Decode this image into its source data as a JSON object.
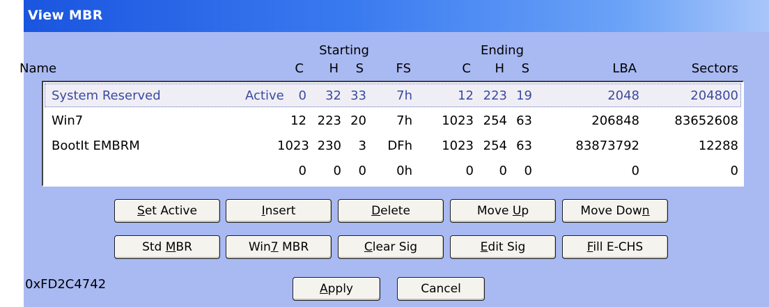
{
  "window": {
    "title": "View MBR"
  },
  "headers": {
    "group_starting": "Starting",
    "group_ending": "Ending",
    "name": "Name",
    "start_c": "C",
    "start_h": "H",
    "start_s": "S",
    "fs": "FS",
    "end_c": "C",
    "end_h": "H",
    "end_s": "S",
    "lba": "LBA",
    "sectors": "Sectors"
  },
  "partitions": [
    {
      "name": "System Reserved",
      "flag": "Active",
      "start_c": "0",
      "start_h": "32",
      "start_s": "33",
      "fs": "7h",
      "end_c": "12",
      "end_h": "223",
      "end_s": "19",
      "lba": "2048",
      "sectors": "204800"
    },
    {
      "name": "Win7",
      "flag": "",
      "start_c": "12",
      "start_h": "223",
      "start_s": "20",
      "fs": "7h",
      "end_c": "1023",
      "end_h": "254",
      "end_s": "63",
      "lba": "206848",
      "sectors": "83652608"
    },
    {
      "name": "BootIt EMBRM",
      "flag": "",
      "start_c": "1023",
      "start_h": "230",
      "start_s": "3",
      "fs": "DFh",
      "end_c": "1023",
      "end_h": "254",
      "end_s": "63",
      "lba": "83873792",
      "sectors": "12288"
    },
    {
      "name": "",
      "flag": "",
      "start_c": "0",
      "start_h": "0",
      "start_s": "0",
      "fs": "0h",
      "end_c": "0",
      "end_h": "0",
      "end_s": "0",
      "lba": "0",
      "sectors": "0"
    }
  ],
  "buttons": {
    "set_active": {
      "pre": "",
      "key": "S",
      "post": "et Active"
    },
    "insert": {
      "pre": "",
      "key": "I",
      "post": "nsert"
    },
    "delete": {
      "pre": "",
      "key": "D",
      "post": "elete"
    },
    "move_up": {
      "pre": "Move ",
      "key": "U",
      "post": "p"
    },
    "move_down": {
      "pre": "Move Dow",
      "key": "n",
      "post": ""
    },
    "std_mbr": {
      "pre": "Std ",
      "key": "M",
      "post": "BR"
    },
    "win7_mbr": {
      "pre": "Win",
      "key": "7",
      "post": " MBR"
    },
    "clear_sig": {
      "pre": "",
      "key": "C",
      "post": "lear Sig"
    },
    "edit_sig": {
      "pre": "",
      "key": "E",
      "post": "dit Sig"
    },
    "fill_echs": {
      "pre": "",
      "key": "F",
      "post": "ill E-CHS"
    },
    "apply": {
      "pre": "",
      "key": "A",
      "post": "pply"
    },
    "cancel": {
      "pre": "Cancel",
      "key": "",
      "post": ""
    }
  },
  "disk_signature": "0xFD2C4742",
  "colors": {
    "dialog_background": "#a9b9f2",
    "titlebar_start": "#1a55df",
    "selected_row_text": "#3a4aa0"
  }
}
